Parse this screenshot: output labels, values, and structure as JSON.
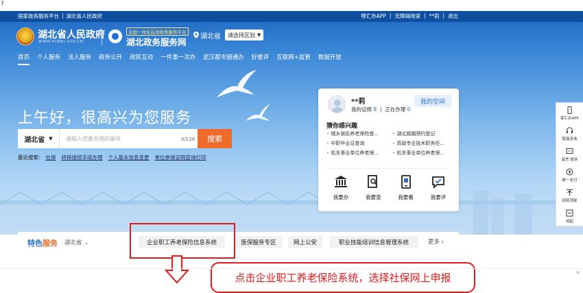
{
  "top_tick": "?",
  "util_bar": {
    "left": [
      "国家政务服务平台",
      "|",
      "湖北省人民政府"
    ],
    "right": [
      "鄂汇办APP",
      "|",
      "无障碍阅读",
      "|",
      "**莉",
      "|",
      "退出"
    ]
  },
  "header": {
    "gov_title": "湖北省人民政府",
    "gov_sub": "WWW.HUBEI.GOV.CN",
    "svc_tag": "全国一体化在线政务服务平台",
    "svc_title": "湖北政务服务网",
    "location": "湖北省",
    "region_select": "请选择区划"
  },
  "nav": [
    "首页",
    "个人服务",
    "法人服务",
    "政务公开",
    "政民互动",
    "一件事一次办",
    "武汉都市圈通办",
    "好差评",
    "互联网+监管",
    "数据开放"
  ],
  "greeting": "上午好，很高兴为您服务",
  "search": {
    "region": "湖北省",
    "placeholder": "请输入您要办理的事项",
    "count": "0/128",
    "button": "搜索"
  },
  "recent": {
    "label": "最近搜索:",
    "items": [
      "社保",
      "转移接续手续办理",
      "个人基本信息变更",
      "单位参保证明查询打印"
    ]
  },
  "user_panel": {
    "name": "**莉",
    "cert_label": "我的证照",
    "cert_count": "8",
    "progress_label": "正在办理",
    "progress_count": "0",
    "my_space": "我的空间",
    "interest_title": "猜你感兴趣",
    "interests": [
      "城乡居民养老保险查...",
      "湖北婚姻预约登记",
      "中职毕业证查询",
      "高级专业技术职务任...",
      "机关事业单位养老保...",
      "机关事业单位养老保..."
    ],
    "actions": [
      "我要办",
      "我要查",
      "我要看",
      "我要评"
    ]
  },
  "side_float": [
    "鄂汇办APP",
    "智能咨询",
    "留言 投诉",
    "统一支付",
    "回到顶部",
    "收起"
  ],
  "feature": {
    "title_a": "特色",
    "title_b": "服务",
    "region": "湖北省",
    "tabs": [
      "企业职工养老保险信息系统",
      "医保服务专区",
      "网上公安",
      "职业技能培训信息管理系统"
    ],
    "more": "更多"
  },
  "callout": "点击企业职工养老保险系统，选择社保网上申报",
  "colors": {
    "primary_blue": "#1f6fd1",
    "search_orange": "#f06a2a",
    "annotation_red": "#e3191c"
  }
}
